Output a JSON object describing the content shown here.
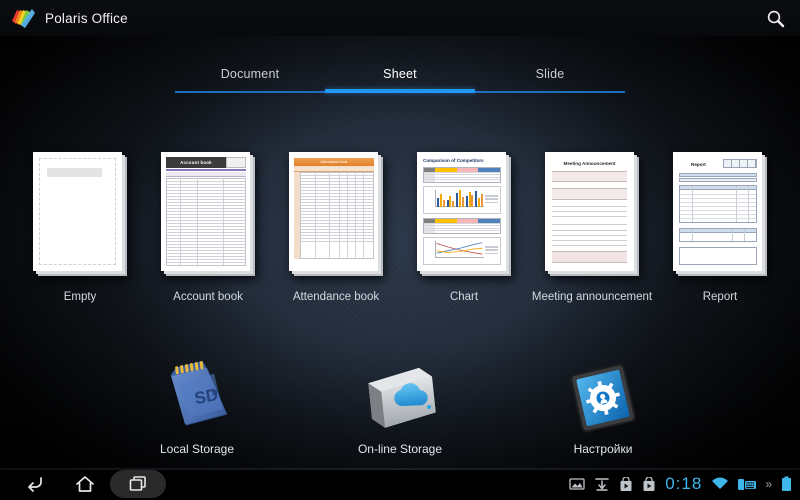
{
  "window": {
    "app_title": "Polaris Office",
    "logo_icon": "polaris-pages-logo",
    "search_icon": "search-icon"
  },
  "tabs": {
    "items": [
      {
        "label": "Document",
        "active": false
      },
      {
        "label": "Sheet",
        "active": true
      },
      {
        "label": "Slide",
        "active": false
      }
    ],
    "active_index": 1,
    "accent_color": "#2196f3",
    "inactive_line_color": "#1d6fbd"
  },
  "templates": {
    "items": [
      {
        "label": "Empty",
        "thumb": "blank-page"
      },
      {
        "label": "Account book",
        "thumb": "account-book-sheet",
        "header_text": "Account book"
      },
      {
        "label": "Attendance book",
        "thumb": "attendance-book-sheet",
        "header_text": "Attendance book"
      },
      {
        "label": "Chart",
        "thumb": "chart-sheet",
        "header_text": "Comparison of Competitors"
      },
      {
        "label": "Meeting announcement",
        "thumb": "meeting-announcement-sheet",
        "header_text": "Meeting Announcement"
      },
      {
        "label": "Report",
        "thumb": "report-sheet",
        "header_text": "Report"
      }
    ]
  },
  "storage": {
    "items": [
      {
        "label": "Local Storage",
        "icon": "sd-card-icon"
      },
      {
        "label": "On-line Storage",
        "icon": "cloud-drive-icon"
      },
      {
        "label": "Настройки",
        "icon": "settings-tablet-gear-icon"
      }
    ]
  },
  "system_bar": {
    "nav": [
      {
        "name": "back",
        "icon": "back-arrow-icon"
      },
      {
        "name": "home",
        "icon": "home-icon"
      },
      {
        "name": "recents",
        "icon": "recent-apps-icon"
      }
    ],
    "status": {
      "icons": [
        "screenshot-image-icon",
        "download-icon",
        "play-store-icon",
        "play-store-icon"
      ],
      "clock": "0:18",
      "wifi_icon": "wifi-icon",
      "keyboard_icon": "keyboard-icon",
      "more_icon": "chevron-more-icon",
      "battery_icon": "battery-icon",
      "accent_color": "#3eb6e8"
    }
  }
}
